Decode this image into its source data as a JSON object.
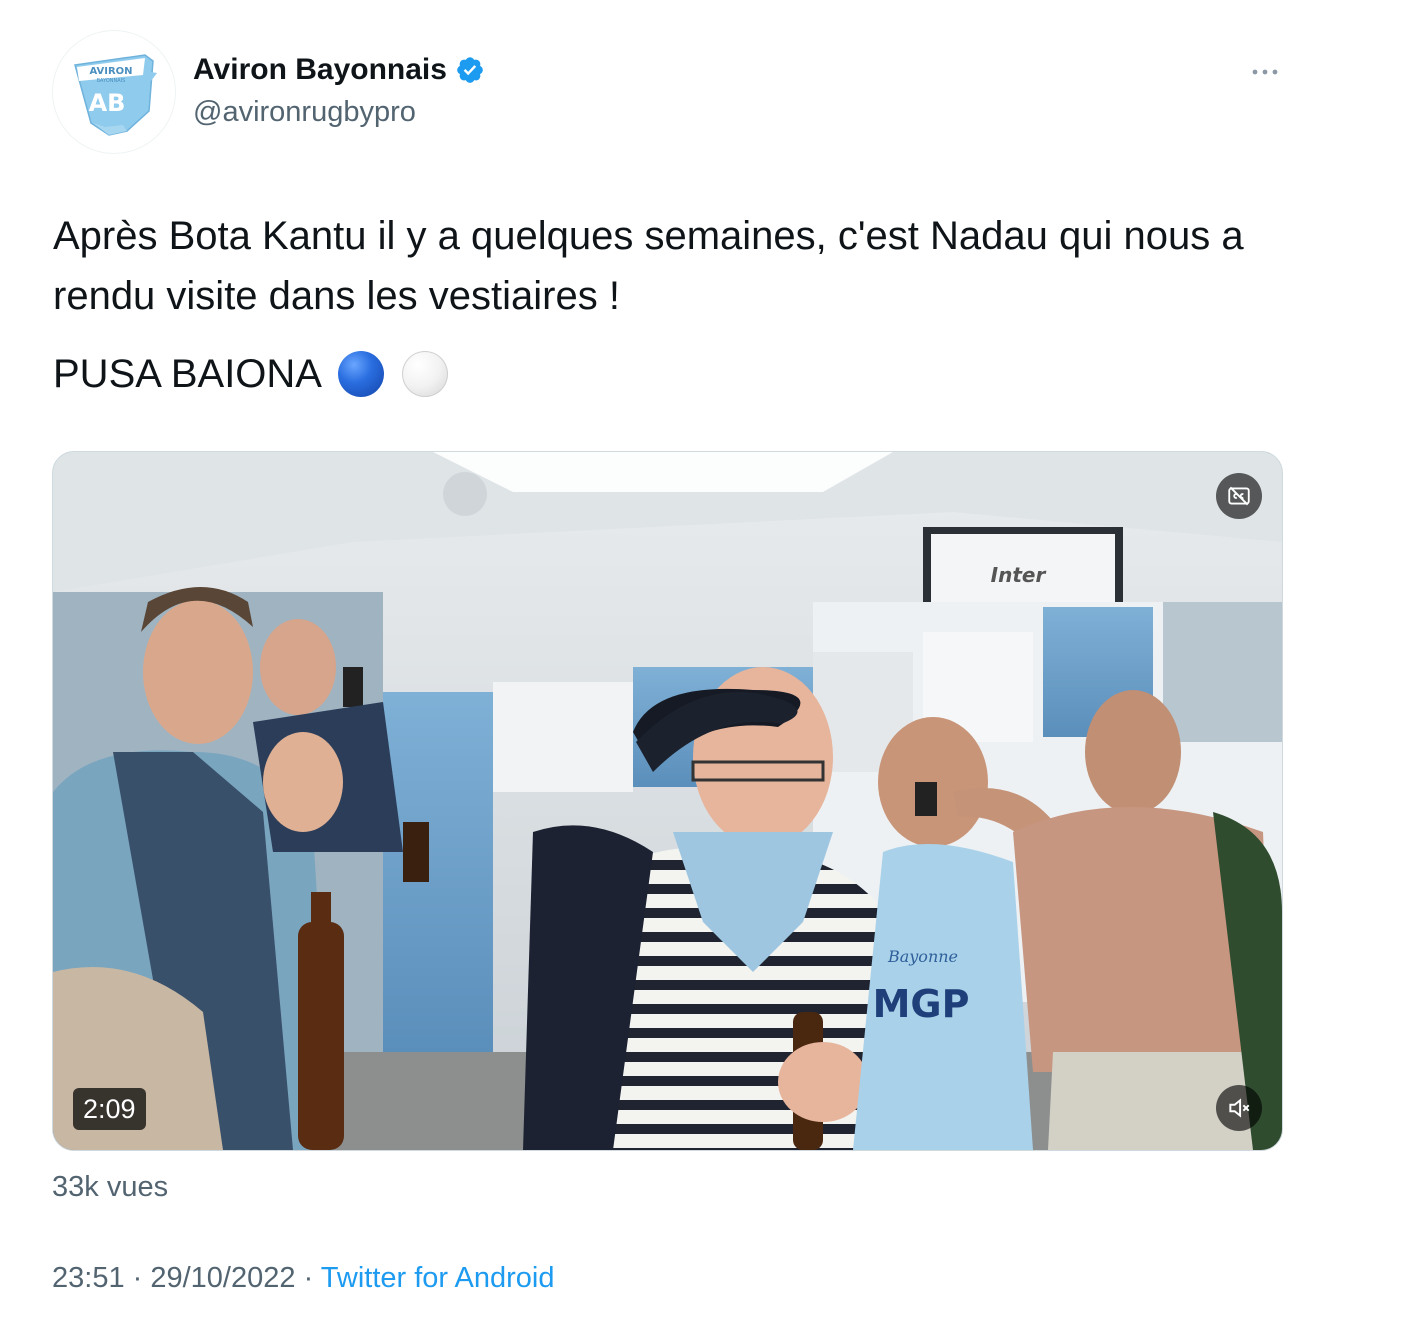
{
  "tweet": {
    "author": {
      "display_name": "Aviron Bayonnais",
      "handle": "@avironrugbypro",
      "verified": true,
      "avatar_icon": "aviron-bayonnais-logo-icon",
      "logo_text_top": "AVIRON",
      "logo_text_sub": "BAYONNAIS",
      "logo_monogram": "AB"
    },
    "more_icon": "more-dots-icon",
    "text": {
      "line1": "Après Bota Kantu il y a quelques semaines, c'est Nadau qui nous a rendu visite dans les vestiaires !",
      "line2": "PUSA BAIONA",
      "emojis": [
        "blue-circle",
        "white-circle"
      ]
    },
    "video": {
      "duration": "2:09",
      "cc_icon": "captions-off-icon",
      "mute_icon": "volume-muted-icon",
      "scene_sign": "Inter",
      "jersey_text": "MGP",
      "jersey_text2": "Bayonne"
    },
    "views": "33k vues",
    "time": "23:51",
    "separator": " · ",
    "date": "29/10/2022",
    "source": "Twitter for Android"
  },
  "colors": {
    "text_primary": "#0f1419",
    "text_secondary": "#536471",
    "link": "#1d9bf0",
    "verified": "#1d9bf0",
    "brand_light_blue": "#7cc3e8"
  }
}
